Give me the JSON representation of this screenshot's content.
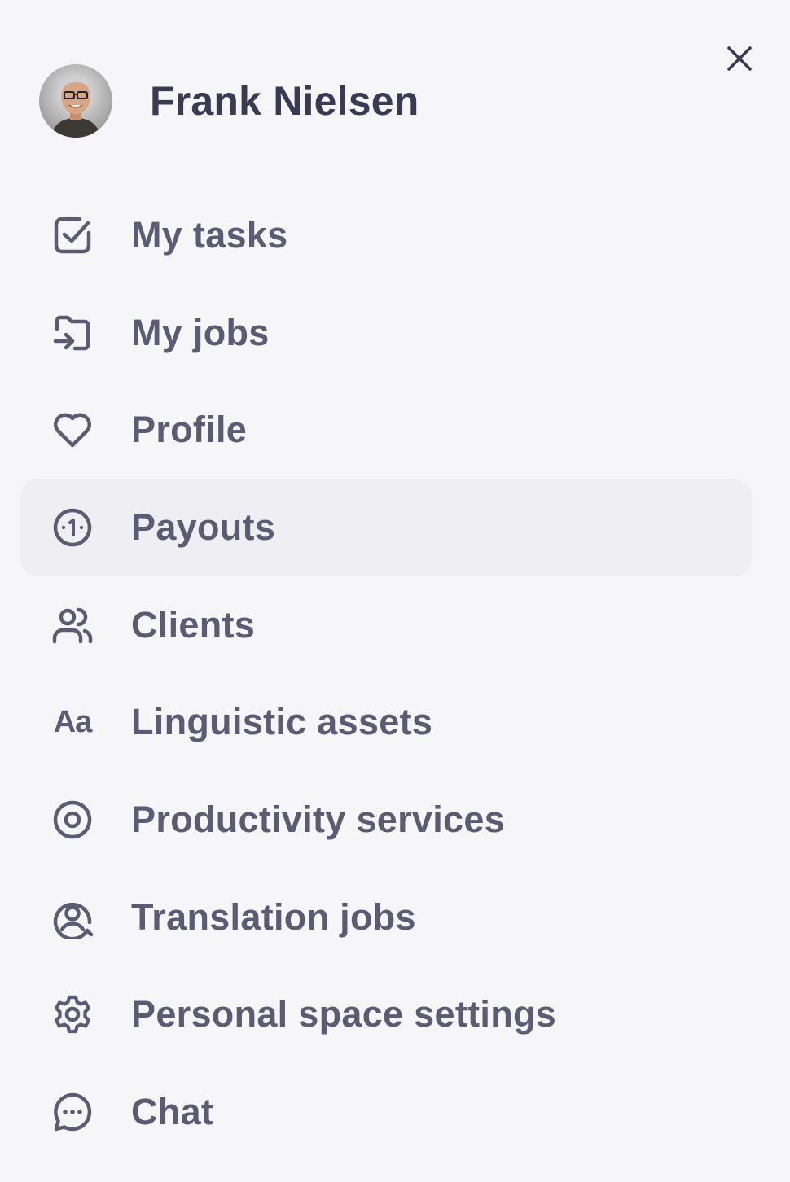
{
  "user": {
    "name": "Frank Nielsen"
  },
  "close_label": "Close",
  "nav": {
    "items": [
      {
        "label": "My tasks",
        "icon": "checkbox-icon"
      },
      {
        "label": "My jobs",
        "icon": "folder-arrow-icon"
      },
      {
        "label": "Profile",
        "icon": "heart-icon"
      },
      {
        "label": "Payouts",
        "icon": "coin-icon",
        "active": true
      },
      {
        "label": "Clients",
        "icon": "users-icon"
      },
      {
        "label": "Linguistic assets",
        "icon": "aa-icon",
        "glyph": "Aa"
      },
      {
        "label": "Productivity services",
        "icon": "target-icon"
      },
      {
        "label": "Translation jobs",
        "icon": "user-circle-icon"
      },
      {
        "label": "Personal space settings",
        "icon": "gear-icon"
      },
      {
        "label": "Chat",
        "icon": "chat-icon"
      }
    ]
  },
  "colors": {
    "background": "#f6f6f9",
    "active_item": "#efeff3",
    "text": "#5d5b72",
    "title": "#3c3a52"
  }
}
